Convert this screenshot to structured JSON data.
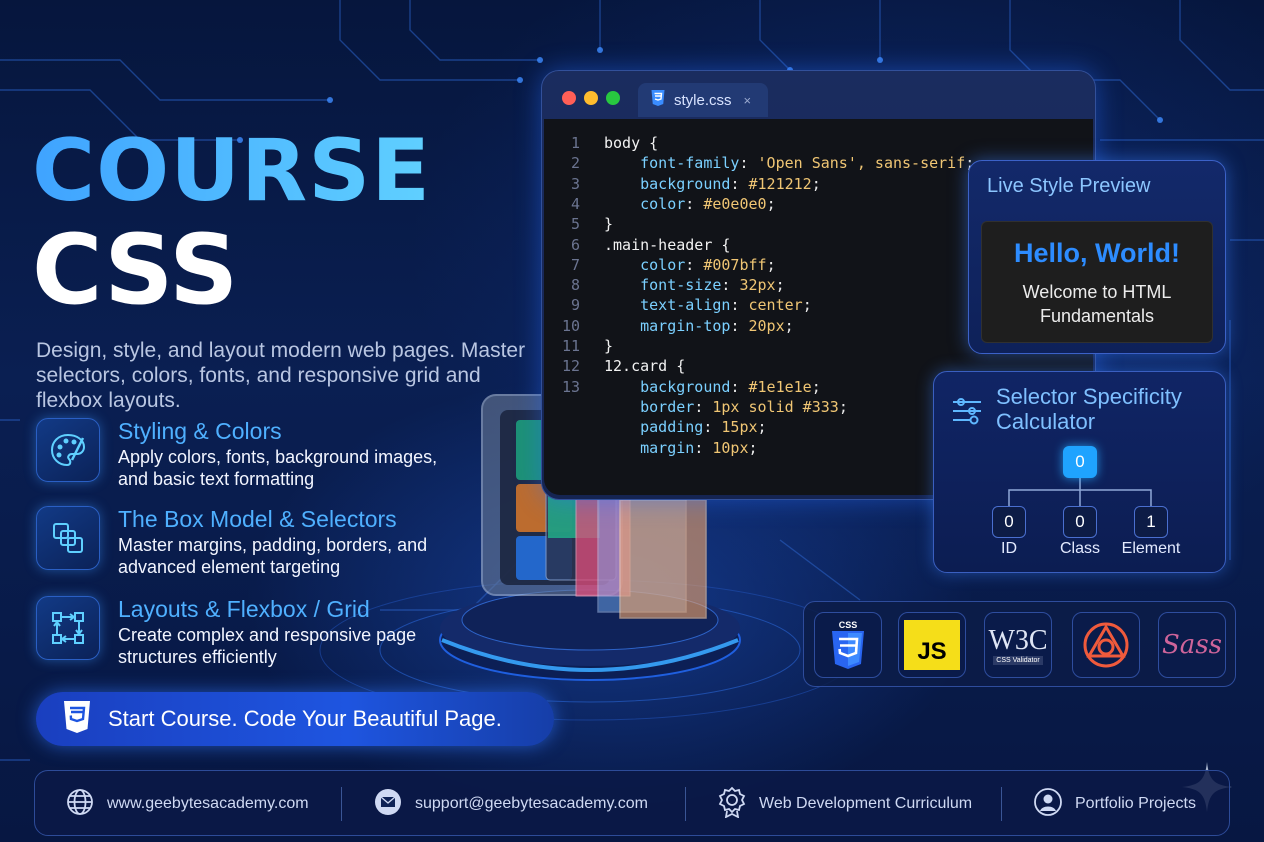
{
  "hero": {
    "title_line1": "COURSE",
    "title_line2": "CSS",
    "description": "Design, style, and layout modern web pages. Master selectors, colors, fonts, and responsive grid and flexbox layouts."
  },
  "features": [
    {
      "title": "Styling & Colors",
      "description": "Apply colors, fonts, background images, and basic text formatting",
      "icon": "palette-icon"
    },
    {
      "title": "The Box Model & Selectors",
      "description": "Master margins, padding, borders, and advanced element targeting",
      "icon": "layers-icon"
    },
    {
      "title": "Layouts & Flexbox / Grid",
      "description": "Create complex and responsive page structures efficiently",
      "icon": "layout-arrows-icon"
    }
  ],
  "cta": {
    "label": "Start Course. Code Your Beautiful Page.",
    "icon": "css3-icon"
  },
  "editor": {
    "tab_label": "style.css",
    "tab_close": "×",
    "lines": [
      {
        "n": "1",
        "text": "body {"
      },
      {
        "n": "2",
        "text": "    font-family: 'Open Sans', sans-serif;"
      },
      {
        "n": "3",
        "text": "    background: #121212;"
      },
      {
        "n": "4",
        "text": "    color: #e0e0e0;"
      },
      {
        "n": "5",
        "text": "}"
      },
      {
        "n": "6",
        "text": ".main-header {"
      },
      {
        "n": "7",
        "text": "    color: #007bff;"
      },
      {
        "n": "8",
        "text": "    font-size: 32px;"
      },
      {
        "n": "9",
        "text": "    text-align: center;"
      },
      {
        "n": "10",
        "text": "    margin-top: 20px;"
      },
      {
        "n": "11",
        "text": "}"
      },
      {
        "n": "12",
        "text": "12.card {"
      },
      {
        "n": "13",
        "text": "    background: #1e1e1e;"
      },
      {
        "n": "",
        "text": "    border: 1px solid #333;"
      },
      {
        "n": "",
        "text": "    padding: 15px;"
      },
      {
        "n": "",
        "text": "    margin: 10px;"
      }
    ]
  },
  "preview": {
    "title": "Live Style Preview",
    "heading": "Hello, World!",
    "body": "Welcome to HTML Fundamentals"
  },
  "specificity": {
    "title": "Selector Specificity Calculator",
    "total": "0",
    "parts": [
      {
        "label": "ID",
        "value": "0"
      },
      {
        "label": "Class",
        "value": "0"
      },
      {
        "label": "Element",
        "value": "1"
      }
    ]
  },
  "tools": [
    {
      "name": "css3-logo",
      "label": "CSS"
    },
    {
      "name": "javascript-logo",
      "label": "JS"
    },
    {
      "name": "w3c-validator-logo",
      "label": "W3C",
      "sub": "CSS Validator"
    },
    {
      "name": "triangle-circle-logo",
      "label": ""
    },
    {
      "name": "sass-logo",
      "label": "Sass"
    }
  ],
  "footer": [
    {
      "icon": "globe-icon",
      "text": "www.geebytesacademy.com"
    },
    {
      "icon": "mail-icon",
      "text": "support@geebytesacademy.com"
    },
    {
      "icon": "badge-icon",
      "text": "Web Development Curriculum"
    },
    {
      "icon": "user-icon",
      "text": "Portfolio Projects"
    }
  ],
  "colors": {
    "accent": "#4fb0ff",
    "background": "#0a1f52",
    "cta": "#1e55e0"
  }
}
